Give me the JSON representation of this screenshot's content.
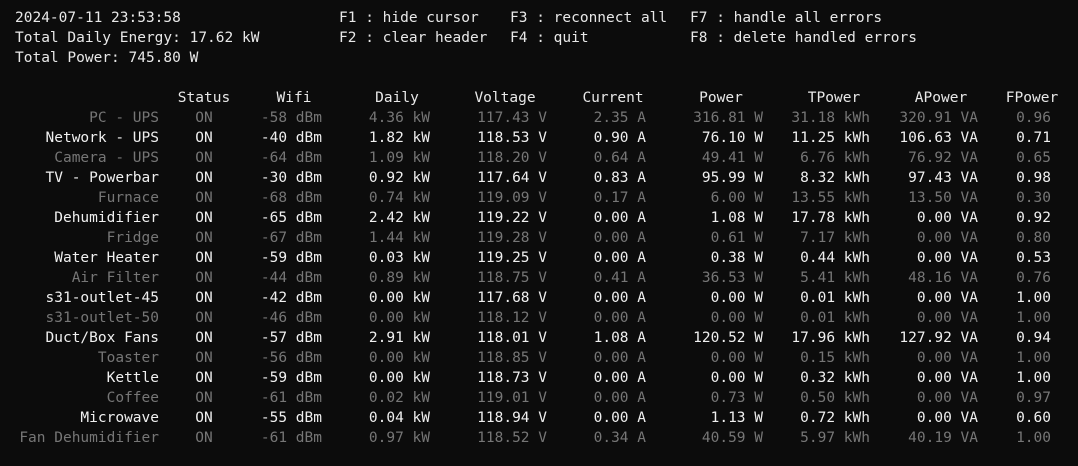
{
  "header": {
    "datetime": "2024-07-11 23:53:58",
    "total_daily_energy": "Total Daily Energy: 17.62 kW",
    "total_power": "Total Power: 745.80 W"
  },
  "hotkeys": {
    "f1": "F1 : hide cursor",
    "f2": "F2 : clear header",
    "f3": "F3 : reconnect all",
    "f4": "F4 : quit",
    "f7": "F7 : handle all errors",
    "f8": "F8 : delete handled errors"
  },
  "table": {
    "columns": [
      "Status",
      "Wifi",
      "Daily",
      "Voltage",
      "Current",
      "Power",
      "TPower",
      "APower",
      "FPower"
    ],
    "rows": [
      {
        "name": "PC - UPS",
        "status": "ON",
        "wifi": "-58 dBm",
        "daily": "4.36 kW",
        "voltage": "117.43 V",
        "current": "2.35 A",
        "power": "316.81 W",
        "tpower": "31.18 kWh",
        "apower": "320.91 VA",
        "fpower": "0.96",
        "bright": false
      },
      {
        "name": "Network - UPS",
        "status": "ON",
        "wifi": "-40 dBm",
        "daily": "1.82 kW",
        "voltage": "118.53 V",
        "current": "0.90 A",
        "power": "76.10 W",
        "tpower": "11.25 kWh",
        "apower": "106.63 VA",
        "fpower": "0.71",
        "bright": true
      },
      {
        "name": "Camera - UPS",
        "status": "ON",
        "wifi": "-64 dBm",
        "daily": "1.09 kW",
        "voltage": "118.20 V",
        "current": "0.64 A",
        "power": "49.41 W",
        "tpower": "6.76 kWh",
        "apower": "76.92 VA",
        "fpower": "0.65",
        "bright": false
      },
      {
        "name": "TV - Powerbar",
        "status": "ON",
        "wifi": "-30 dBm",
        "daily": "0.92 kW",
        "voltage": "117.64 V",
        "current": "0.83 A",
        "power": "95.99 W",
        "tpower": "8.32 kWh",
        "apower": "97.43 VA",
        "fpower": "0.98",
        "bright": true
      },
      {
        "name": "Furnace",
        "status": "ON",
        "wifi": "-68 dBm",
        "daily": "0.74 kW",
        "voltage": "119.09 V",
        "current": "0.17 A",
        "power": "6.00 W",
        "tpower": "13.55 kWh",
        "apower": "13.50 VA",
        "fpower": "0.30",
        "bright": false
      },
      {
        "name": "Dehumidifier",
        "status": "ON",
        "wifi": "-65 dBm",
        "daily": "2.42 kW",
        "voltage": "119.22 V",
        "current": "0.00 A",
        "power": "1.08 W",
        "tpower": "17.78 kWh",
        "apower": "0.00 VA",
        "fpower": "0.92",
        "bright": true
      },
      {
        "name": "Fridge",
        "status": "ON",
        "wifi": "-67 dBm",
        "daily": "1.44 kW",
        "voltage": "119.28 V",
        "current": "0.00 A",
        "power": "0.61 W",
        "tpower": "7.17 kWh",
        "apower": "0.00 VA",
        "fpower": "0.80",
        "bright": false
      },
      {
        "name": "Water Heater",
        "status": "ON",
        "wifi": "-59 dBm",
        "daily": "0.03 kW",
        "voltage": "119.25 V",
        "current": "0.00 A",
        "power": "0.38 W",
        "tpower": "0.44 kWh",
        "apower": "0.00 VA",
        "fpower": "0.53",
        "bright": true
      },
      {
        "name": "Air Filter",
        "status": "ON",
        "wifi": "-44 dBm",
        "daily": "0.89 kW",
        "voltage": "118.75 V",
        "current": "0.41 A",
        "power": "36.53 W",
        "tpower": "5.41 kWh",
        "apower": "48.16 VA",
        "fpower": "0.76",
        "bright": false
      },
      {
        "name": "s31-outlet-45",
        "status": "ON",
        "wifi": "-42 dBm",
        "daily": "0.00 kW",
        "voltage": "117.68 V",
        "current": "0.00 A",
        "power": "0.00 W",
        "tpower": "0.01 kWh",
        "apower": "0.00 VA",
        "fpower": "1.00",
        "bright": true
      },
      {
        "name": "s31-outlet-50",
        "status": "ON",
        "wifi": "-46 dBm",
        "daily": "0.00 kW",
        "voltage": "118.12 V",
        "current": "0.00 A",
        "power": "0.00 W",
        "tpower": "0.01 kWh",
        "apower": "0.00 VA",
        "fpower": "1.00",
        "bright": false
      },
      {
        "name": "Duct/Box Fans",
        "status": "ON",
        "wifi": "-57 dBm",
        "daily": "2.91 kW",
        "voltage": "118.01 V",
        "current": "1.08 A",
        "power": "120.52 W",
        "tpower": "17.96 kWh",
        "apower": "127.92 VA",
        "fpower": "0.94",
        "bright": true
      },
      {
        "name": "Toaster",
        "status": "ON",
        "wifi": "-56 dBm",
        "daily": "0.00 kW",
        "voltage": "118.85 V",
        "current": "0.00 A",
        "power": "0.00 W",
        "tpower": "0.15 kWh",
        "apower": "0.00 VA",
        "fpower": "1.00",
        "bright": false
      },
      {
        "name": "Kettle",
        "status": "ON",
        "wifi": "-59 dBm",
        "daily": "0.00 kW",
        "voltage": "118.73 V",
        "current": "0.00 A",
        "power": "0.00 W",
        "tpower": "0.32 kWh",
        "apower": "0.00 VA",
        "fpower": "1.00",
        "bright": true
      },
      {
        "name": "Coffee",
        "status": "ON",
        "wifi": "-61 dBm",
        "daily": "0.02 kW",
        "voltage": "119.01 V",
        "current": "0.00 A",
        "power": "0.73 W",
        "tpower": "0.50 kWh",
        "apower": "0.00 VA",
        "fpower": "0.97",
        "bright": false
      },
      {
        "name": "Microwave",
        "status": "ON",
        "wifi": "-55 dBm",
        "daily": "0.04 kW",
        "voltage": "118.94 V",
        "current": "0.00 A",
        "power": "1.13 W",
        "tpower": "0.72 kWh",
        "apower": "0.00 VA",
        "fpower": "0.60",
        "bright": true
      },
      {
        "name": "Fan Dehumidifier",
        "status": "ON",
        "wifi": "-61 dBm",
        "daily": "0.97 kW",
        "voltage": "118.52 V",
        "current": "0.34 A",
        "power": "40.59 W",
        "tpower": "5.97 kWh",
        "apower": "40.19 VA",
        "fpower": "1.00",
        "bright": false
      }
    ]
  },
  "colors": {
    "background": "#0c0c0c",
    "text_bright": "#f0f0f0",
    "text_dim": "#767676"
  }
}
